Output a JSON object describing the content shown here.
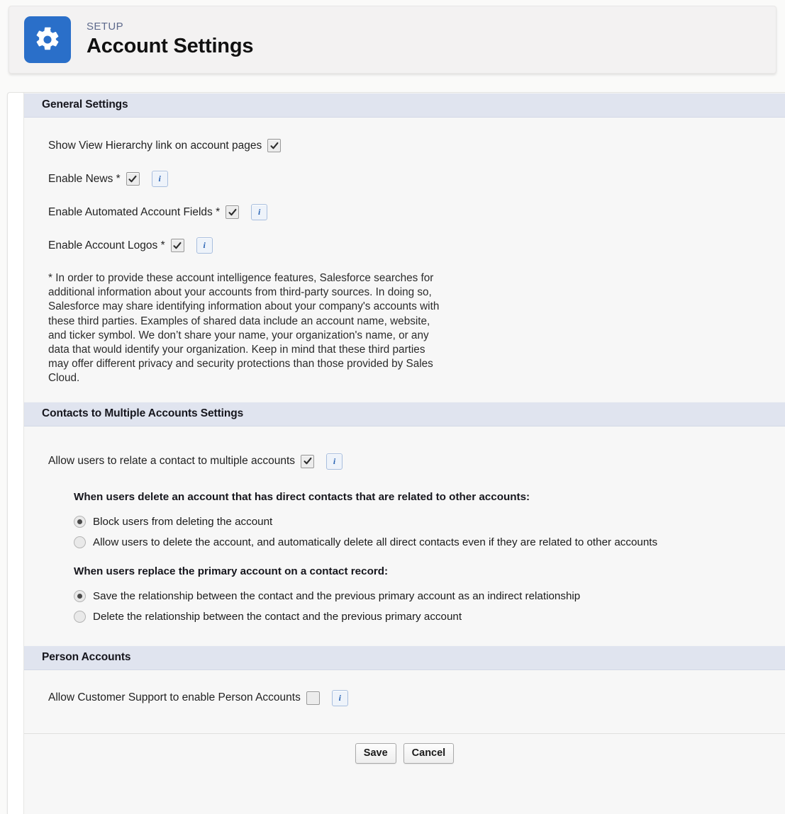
{
  "header": {
    "eyebrow": "SETUP",
    "title": "Account Settings",
    "icon": "gear-icon",
    "icon_bg": "#2a6fc9"
  },
  "sections": {
    "general": {
      "title": "General Settings",
      "rows": [
        {
          "label": "Show View Hierarchy link on account pages",
          "checked": true,
          "has_info": false
        },
        {
          "label": "Enable News *",
          "checked": true,
          "has_info": true
        },
        {
          "label": "Enable Automated Account Fields *",
          "checked": true,
          "has_info": true
        },
        {
          "label": "Enable Account Logos *",
          "checked": true,
          "has_info": true
        }
      ],
      "footnote": "* In order to provide these account intelligence features, Salesforce searches for additional information about your accounts from third-party sources. In doing so, Salesforce may share identifying information about your company's accounts with these third parties. Examples of shared data include an account name, website, and ticker symbol. We don’t share your name, your organization's name, or any data that would identify your organization. Keep in mind that these third parties may offer different privacy and security protections than those provided by Sales Cloud."
    },
    "contacts": {
      "title": "Contacts to Multiple Accounts Settings",
      "row": {
        "label": "Allow users to relate a contact to multiple accounts",
        "checked": true,
        "has_info": true
      },
      "group1": {
        "question": "When users delete an account that has direct contacts that are related to other accounts:",
        "options": [
          {
            "label": "Block users from deleting the account",
            "selected": true
          },
          {
            "label": "Allow users to delete the account, and automatically delete all direct contacts even if they are related to other accounts",
            "selected": false
          }
        ]
      },
      "group2": {
        "question": "When users replace the primary account on a contact record:",
        "options": [
          {
            "label": "Save the relationship between the contact and the previous primary account as an indirect relationship",
            "selected": true
          },
          {
            "label": "Delete the relationship between the contact and the previous primary account",
            "selected": false
          }
        ]
      }
    },
    "person_accounts": {
      "title": "Person Accounts",
      "row": {
        "label": "Allow Customer Support to enable Person Accounts",
        "checked": false,
        "has_info": true
      }
    }
  },
  "footer": {
    "save_label": "Save",
    "cancel_label": "Cancel"
  },
  "info_icon_glyph": "i"
}
